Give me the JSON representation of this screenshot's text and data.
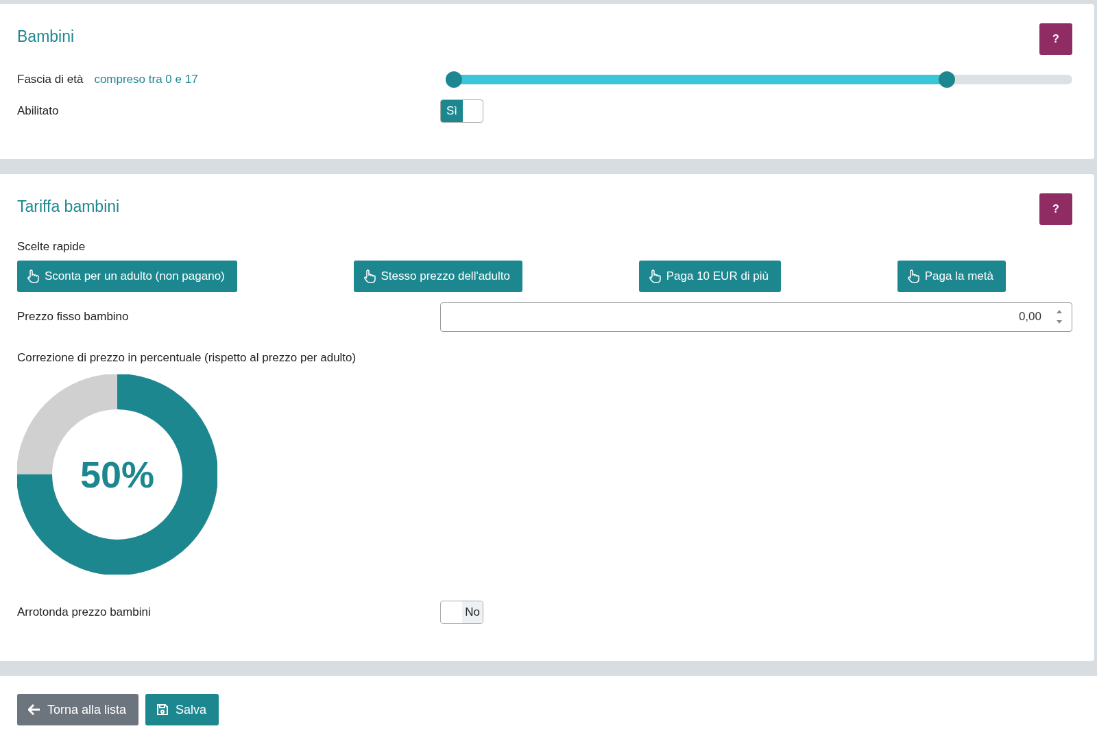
{
  "sections": [
    {
      "title": "Bambini",
      "help": "?",
      "rows": [
        {
          "kind": "range",
          "label": "Fascia di età",
          "value_text": "compreso tra 0 e 17",
          "level": 0.81
        },
        {
          "kind": "toggle",
          "label": "Abilitato",
          "on": true,
          "toggle_label": "Sì"
        }
      ]
    },
    {
      "title": "Tariffa bambini",
      "help": "?",
      "rows": [
        {
          "kind": "quick",
          "label": "Scelte rapide",
          "buttons": [
            "Sconta per un adulto (non pagano)",
            "Stesso prezzo dell'adulto",
            "Paga 10 EUR di più",
            "Paga la metà"
          ]
        },
        {
          "kind": "number",
          "label": "Prezzo fisso bambino",
          "value": "0,00"
        },
        {
          "kind": "donut",
          "label": "Correzione di prezzo in percentuale (rispetto al prezzo per adulto)",
          "level": 0.75,
          "center_text": "50%"
        },
        {
          "kind": "toggle",
          "label": "Arrotonda prezzo bambini",
          "on": false,
          "toggle_label": "No"
        }
      ]
    }
  ],
  "footer": {
    "back": "Torna alla lista",
    "save": "Salva"
  }
}
